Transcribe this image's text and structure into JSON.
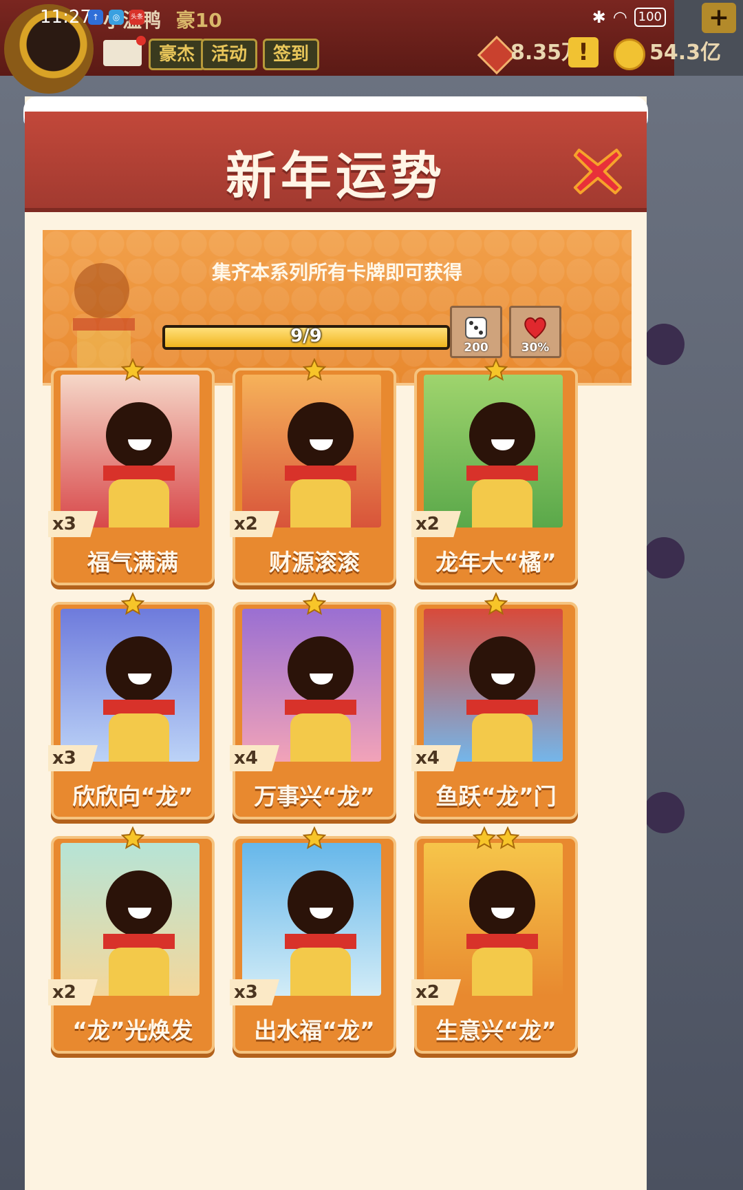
{
  "status_bar": {
    "time": "11:27",
    "battery": "100",
    "apps": [
      "↑",
      "◎",
      "头条"
    ]
  },
  "background": {
    "player_name": "小温鸭",
    "player_rank": "豪10",
    "tabs": [
      "豪杰",
      "活动",
      "签到"
    ],
    "gems": "8.35万",
    "coins": "54.3亿",
    "warn": "!",
    "plus": "+"
  },
  "modal": {
    "title": "新年运势",
    "banner_text": "集齐本系列所有卡牌即可获得",
    "progress_label": "9/9",
    "progress_value": 1.0,
    "rewards": [
      {
        "icon": "dice-icon",
        "label": "200"
      },
      {
        "icon": "heart-icon",
        "label": "30%"
      }
    ]
  },
  "cards": [
    {
      "name": "福气满满",
      "count": "x3",
      "stars": 1,
      "bg": [
        "#f5d7c8",
        "#d8484a"
      ]
    },
    {
      "name": "财源滚滚",
      "count": "x2",
      "stars": 1,
      "bg": [
        "#f6b25a",
        "#d8543a"
      ]
    },
    {
      "name": "龙年大“橘”",
      "count": "x2",
      "stars": 1,
      "bg": [
        "#9fd46d",
        "#5aa84a"
      ]
    },
    {
      "name": "欣欣向“龙”",
      "count": "x3",
      "stars": 1,
      "bg": [
        "#6e7bdc",
        "#bcd3f7"
      ]
    },
    {
      "name": "万事兴“龙”",
      "count": "x4",
      "stars": 1,
      "bg": [
        "#9a6fd2",
        "#f2a3b8"
      ]
    },
    {
      "name": "鱼跃“龙”门",
      "count": "x4",
      "stars": 1,
      "bg": [
        "#d84a3a",
        "#74b6ea"
      ]
    },
    {
      "name": "“龙”光焕发",
      "count": "x2",
      "stars": 1,
      "bg": [
        "#b6e4d6",
        "#f4d79b"
      ]
    },
    {
      "name": "出水福“龙”",
      "count": "x3",
      "stars": 1,
      "bg": [
        "#66b7ea",
        "#d2ecf7"
      ]
    },
    {
      "name": "生意兴“龙”",
      "count": "x2",
      "stars": 2,
      "bg": [
        "#f6c54a",
        "#e8892f"
      ]
    }
  ]
}
